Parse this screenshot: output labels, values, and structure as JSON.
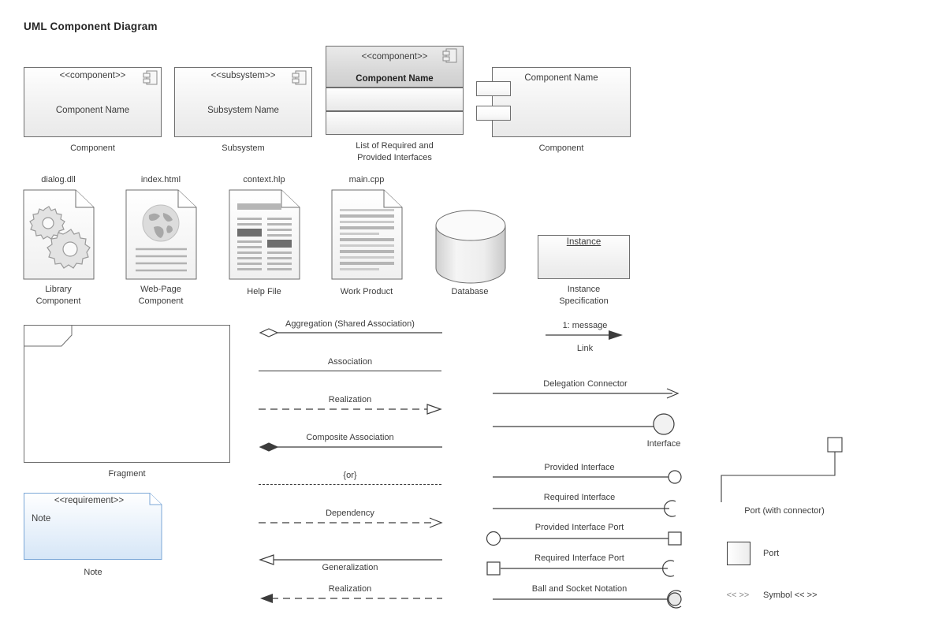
{
  "page": {
    "title": "UML Component Diagram",
    "background": "#ffffff",
    "stroke": "#6e6e6e",
    "text_color": "#3c3c3c",
    "note_accent": "#7ba7d7"
  },
  "components": [
    {
      "id": "component",
      "stereotype": "<<component>>",
      "name": "Component Name",
      "caption": "Component",
      "icon": "component-icon"
    },
    {
      "id": "subsystem",
      "stereotype": "<<subsystem>>",
      "name": "Subsystem Name",
      "caption": "Subsystem",
      "icon": "component-icon"
    },
    {
      "id": "interfaces-list",
      "stereotype": "<<component>>",
      "name": "Component Name",
      "caption_line1": "List of Required and",
      "caption_line2": "Provided Interfaces",
      "icon": "component-icon",
      "compartments": 2
    },
    {
      "id": "component-with-ports",
      "name": "Component Name",
      "caption": "Component",
      "port_count": 2
    }
  ],
  "artifacts": [
    {
      "id": "library",
      "filename": "dialog.dll",
      "caption_line1": "Library",
      "caption_line2": "Component",
      "icon": "gears-icon"
    },
    {
      "id": "webpage",
      "filename": "index.html",
      "caption_line1": "Web-Page",
      "caption_line2": "Component",
      "icon": "globe-icon"
    },
    {
      "id": "helpfile",
      "filename": "context.hlp",
      "caption_line1": "Help File",
      "caption_line2": "",
      "icon": "two-column-text-icon"
    },
    {
      "id": "workproduct",
      "filename": "main.cpp",
      "caption_line1": "Work Product",
      "caption_line2": "",
      "icon": "lines-text-icon"
    }
  ],
  "database": {
    "caption": "Database",
    "icon": "cylinder-icon"
  },
  "instance_spec": {
    "name": "Instance",
    "caption_line1": "Instance",
    "caption_line2": "Specification"
  },
  "fragment": {
    "caption": "Fragment"
  },
  "note": {
    "stereotype": "<<requirement>>",
    "body": "Note",
    "caption": "Note",
    "border": "#7ba7d7",
    "fill_top": "#ffffff",
    "fill_bottom": "#d6e6f7"
  },
  "relationships": [
    {
      "id": "aggregation",
      "label": "Aggregation (Shared Association)",
      "line": "solid",
      "start": "open-diamond",
      "end": "none"
    },
    {
      "id": "association",
      "label": "Association",
      "line": "solid",
      "start": "none",
      "end": "none"
    },
    {
      "id": "realization-dashed",
      "label": "Realization",
      "line": "dashed",
      "start": "none",
      "end": "hollow-triangle"
    },
    {
      "id": "composite-association",
      "label": "Composite Association",
      "line": "solid",
      "start": "filled-diamond",
      "end": "none"
    },
    {
      "id": "or-constraint",
      "label": "{or}",
      "line": "dashed",
      "start": "none",
      "end": "none"
    },
    {
      "id": "dependency",
      "label": "Dependency",
      "line": "dashed",
      "start": "none",
      "end": "open-arrow"
    },
    {
      "id": "generalization",
      "label": "Generalization",
      "line": "solid",
      "start": "hollow-triangle-left",
      "end": "none"
    },
    {
      "id": "realization-back",
      "label": "Realization",
      "line": "dashed",
      "start": "filled-arrow-left",
      "end": "none"
    }
  ],
  "connectors": [
    {
      "id": "link",
      "label": "1: message",
      "sublabel": "Link",
      "end": "filled-arrow"
    },
    {
      "id": "delegation-connector",
      "label": "Delegation Connector",
      "end": "open-arrow"
    },
    {
      "id": "interface",
      "label": "",
      "sublabel": "Interface",
      "end": "ball"
    },
    {
      "id": "provided-interface",
      "label": "Provided Interface",
      "end": "small-ball"
    },
    {
      "id": "required-interface",
      "label": "Required Interface",
      "end": "socket"
    },
    {
      "id": "provided-interface-port",
      "label": "Provided Interface Port",
      "start": "small-ball",
      "end": "port-square"
    },
    {
      "id": "required-interface-port",
      "label": "Required Interface Port",
      "start": "port-square",
      "end": "socket"
    },
    {
      "id": "ball-and-socket",
      "label": "Ball and Socket Notation",
      "end": "ball-and-socket"
    }
  ],
  "ports": {
    "with_connector_label": "Port (with connector)",
    "port_label": "Port",
    "symbol_glyph": "<<  >>",
    "symbol_label": "Symbol << >>"
  }
}
